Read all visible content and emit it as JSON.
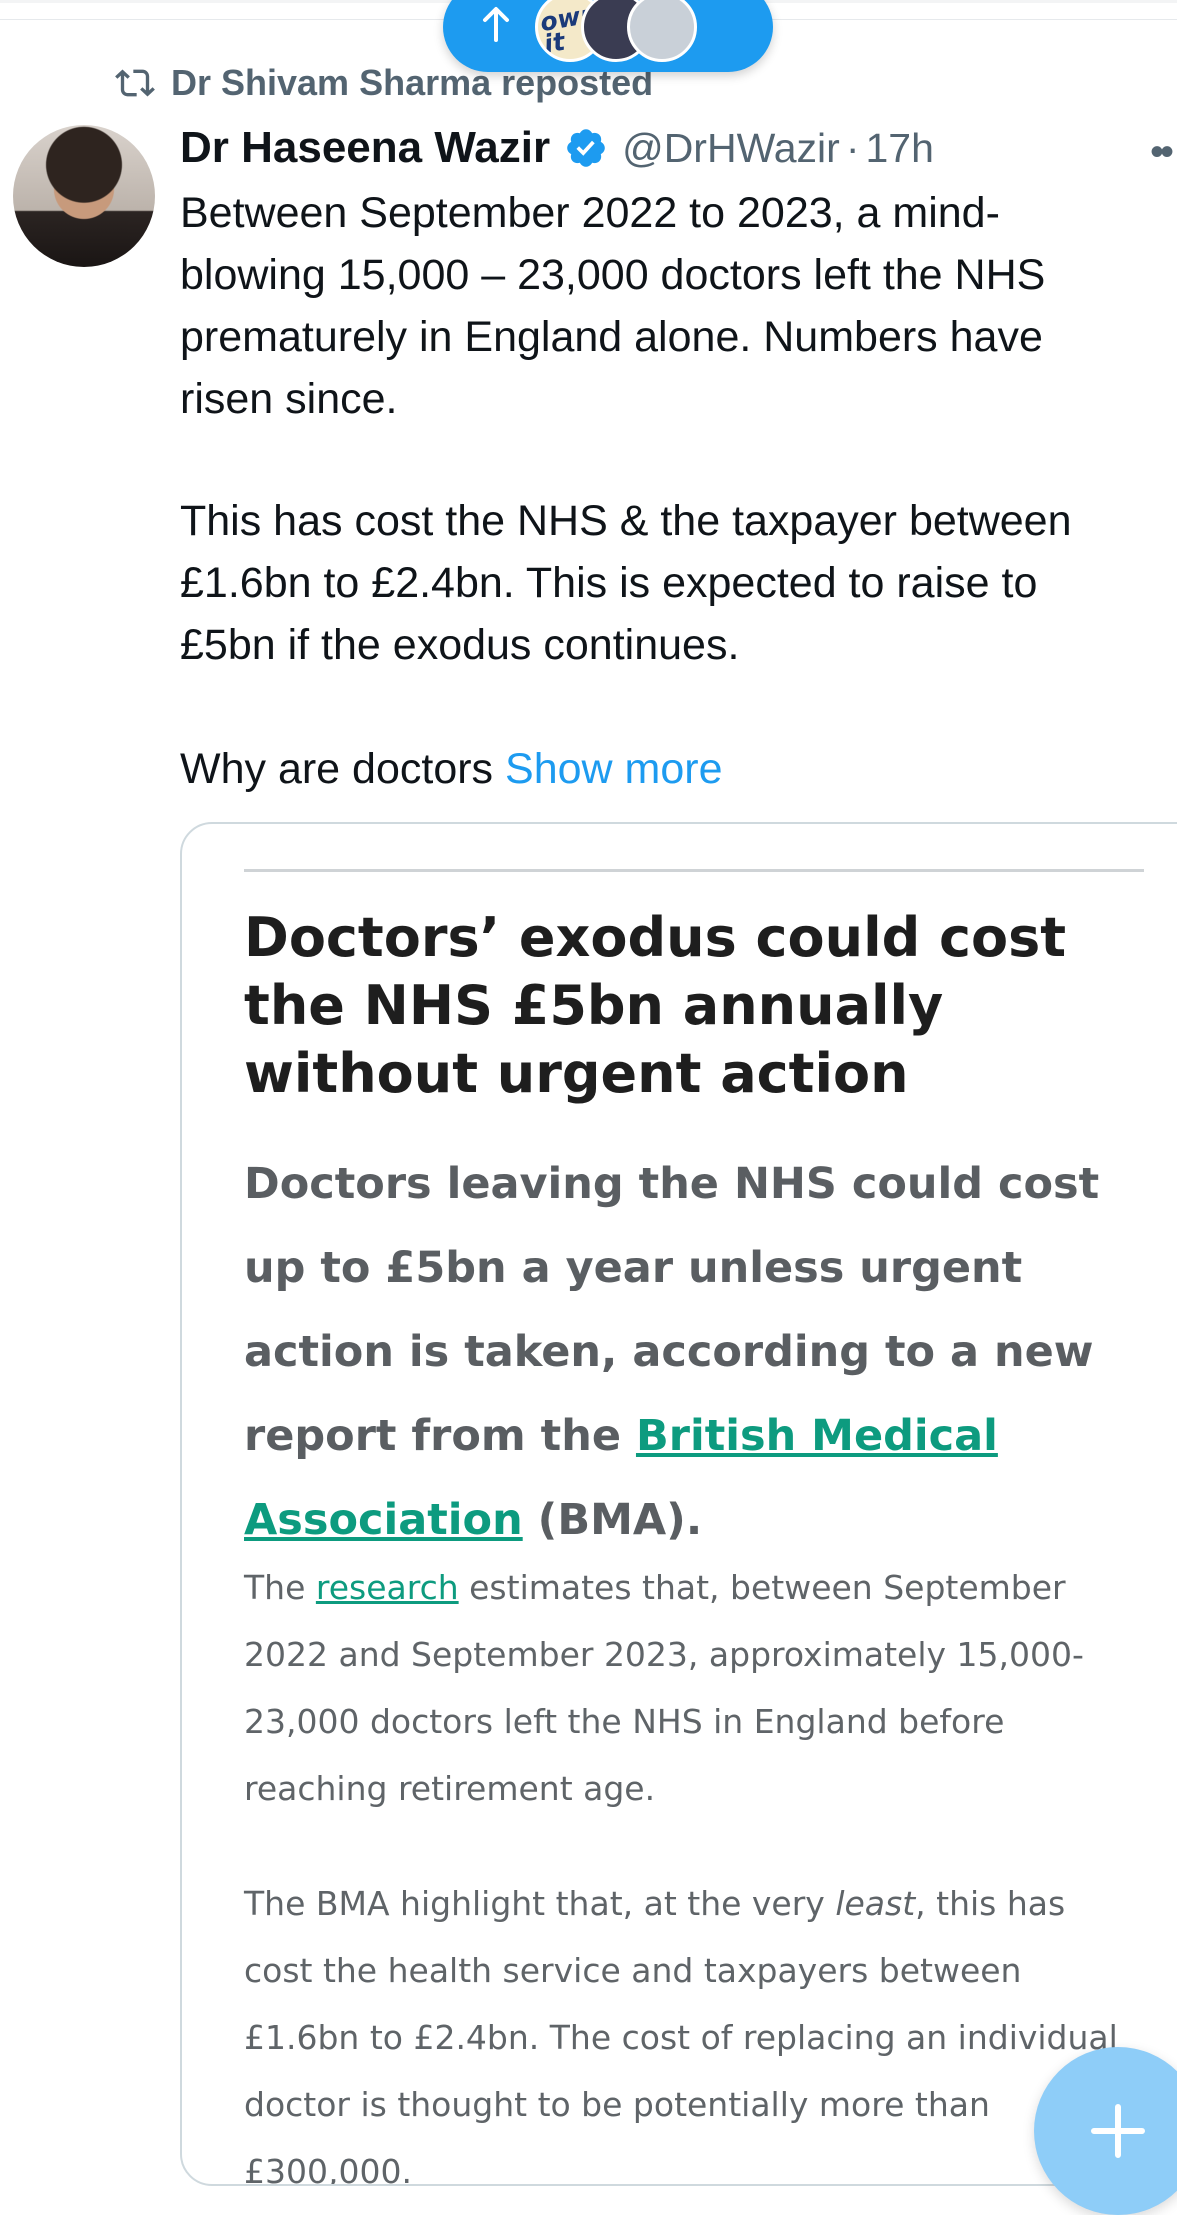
{
  "new_posts_pill": {
    "avatar_1_text": "own it"
  },
  "repost": {
    "label": "Dr Shivam Sharma reposted"
  },
  "post": {
    "author_name": "Dr Haseena Wazir",
    "handle": "@DrHWazir",
    "separator": "·",
    "time": "17h",
    "lines": [
      "Between September 2022 to 2023, a mind-",
      "blowing 15,000 – 23,000 doctors left the NHS",
      "prematurely in England alone. Numbers have",
      "risen since.",
      "This has cost the NHS & the taxpayer between",
      "£1.6bn to £2.4bn. This is expected to raise to",
      "£5bn if the exodus continues.",
      "Why are doctors"
    ],
    "show_more": "Show more"
  },
  "card": {
    "title": "Doctors’ exodus could cost the NHS £5bn annually without urgent action",
    "lede_start": "Doctors leaving the NHS could cost up to £5bn a year unless urgent action is taken, according to a new report from the ",
    "lede_link": "British Medical Association",
    "lede_end": " (BMA).",
    "p1_start": "The ",
    "p1_link": "research",
    "p1_end": " estimates that, between September 2022 and September 2023, approximately 15,000-23,000 doctors left the NHS in England before reaching retirement age.",
    "p2_start": "The BMA highlight that, at the very ",
    "p2_em": "least",
    "p2_end": ", this has cost the health service and taxpayers between £1.6bn to £2.4bn. The cost of replacing an individual doctor is thought to be potentially more than £300,000."
  },
  "colors": {
    "accent": "#1d9bf0",
    "link_green": "#0d9b7f",
    "muted": "#536471"
  },
  "icons": [
    "arrow-up-icon",
    "repost-icon",
    "verified-badge-icon",
    "more-icon",
    "compose-plus-icon"
  ]
}
